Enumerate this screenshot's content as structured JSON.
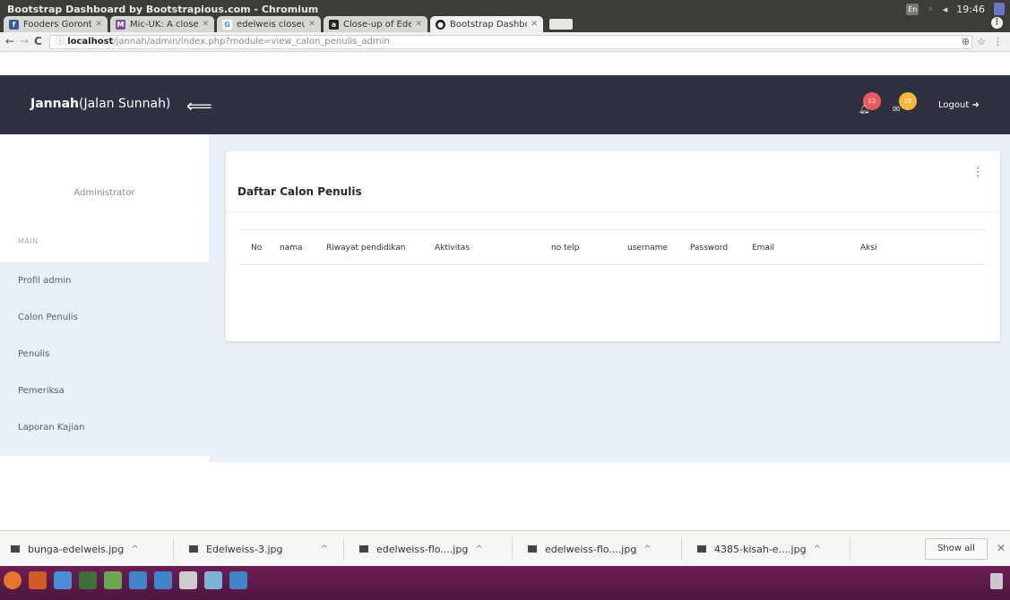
{
  "window": {
    "title": "Bootstrap Dashboard by Bootstrapious.com - Chromium"
  },
  "tray": {
    "keyboard": "En",
    "time": "19:46"
  },
  "tabs": [
    {
      "label": "Fooders Gorontalo",
      "favicon_color": "#3b5998",
      "favicon_text": "f"
    },
    {
      "label": "Mic-UK: A close-up",
      "favicon_color": "#7b4fa0",
      "favicon_text": "M"
    },
    {
      "label": "edelweis closeup -",
      "favicon_color": "#ffffff",
      "favicon_text": "G"
    },
    {
      "label": "Close-up of Edelw",
      "favicon_color": "#222222",
      "favicon_text": "a"
    },
    {
      "label": "Bootstrap Dashbo",
      "favicon_color": "#222222",
      "favicon_text": "●"
    }
  ],
  "address": {
    "host": "localhost",
    "path": "/jannah/admin/index.php?module=view_calon_penulis_admin"
  },
  "header": {
    "brand_bold": "Jannah",
    "brand_rest": "(Jalan Sunnah)",
    "bell_count": "12",
    "mail_count": "10",
    "logout_label": "Logout",
    "bg_color": "#2e3140"
  },
  "sidebar": {
    "role": "Administrator",
    "section": "MAIN",
    "items": [
      {
        "label": "Profil admin"
      },
      {
        "label": "Calon Penulis"
      },
      {
        "label": "Penulis"
      },
      {
        "label": "Pemeriksa"
      },
      {
        "label": "Laporan Kajian"
      }
    ]
  },
  "card": {
    "title": "Daftar Calon Penulis",
    "columns": [
      "No",
      "nama",
      "Riwayat pendidikan",
      "Aktivitas",
      "no telp",
      "username",
      "Password",
      "Email",
      "Aksi"
    ]
  },
  "downloads": {
    "items": [
      {
        "name": "bunga-edelweis.jpg"
      },
      {
        "name": "Edelweiss-3.jpg"
      },
      {
        "name": "edelweiss-flo....jpg"
      },
      {
        "name": "edelweiss-flo....jpg"
      },
      {
        "name": "4385-kisah-e....jpg"
      }
    ],
    "show_all": "Show all"
  }
}
